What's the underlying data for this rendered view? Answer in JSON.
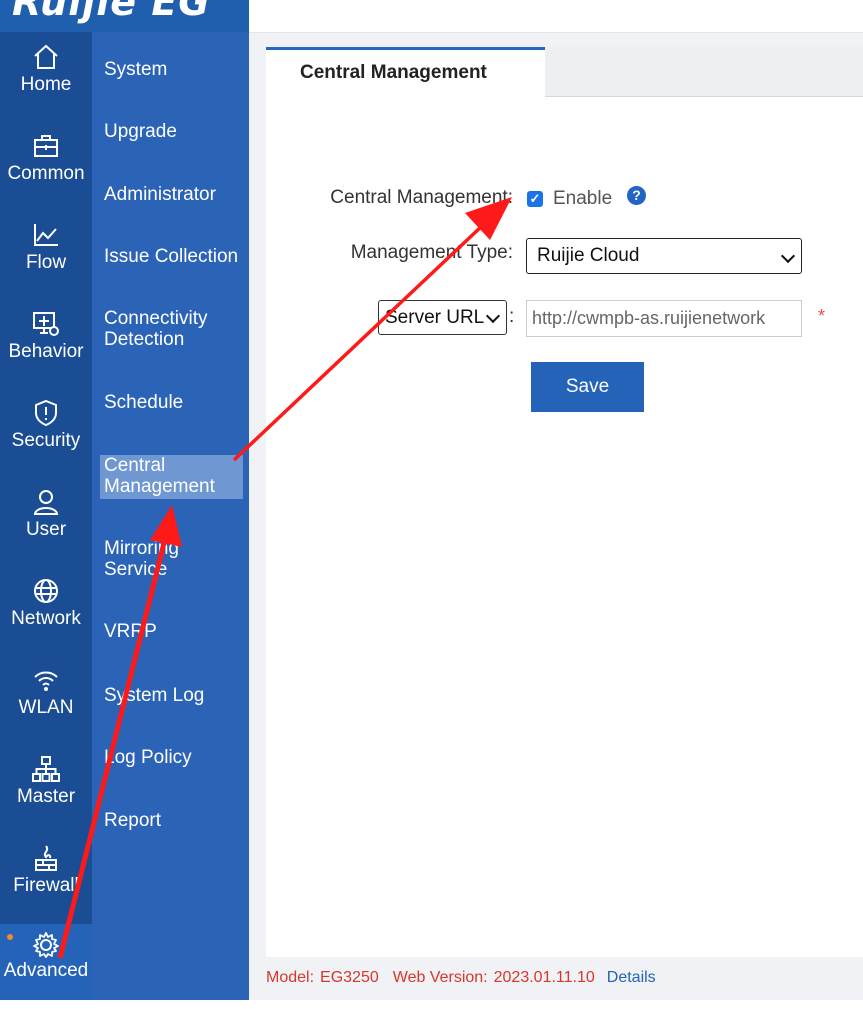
{
  "brand": "Ruijie EG",
  "icon_rail": [
    {
      "label": "Home",
      "icon": "home-icon"
    },
    {
      "label": "Common",
      "icon": "briefcase-icon"
    },
    {
      "label": "Flow",
      "icon": "line-chart-icon"
    },
    {
      "label": "Behavior",
      "icon": "monitor-eye-icon"
    },
    {
      "label": "Security",
      "icon": "shield-icon"
    },
    {
      "label": "User",
      "icon": "user-icon"
    },
    {
      "label": "Network",
      "icon": "globe-icon"
    },
    {
      "label": "WLAN",
      "icon": "wifi-icon"
    },
    {
      "label": "Master",
      "icon": "hierarchy-icon"
    },
    {
      "label": "Firewall",
      "icon": "firewall-icon"
    }
  ],
  "advanced": {
    "label": "Advanced",
    "icon": "gear-icon"
  },
  "sub_menu": [
    "System",
    "Upgrade",
    "Administrator",
    "Issue Collection",
    "Connectivity Detection",
    "Schedule",
    "Central Management",
    "Mirroring Service",
    "VRRP",
    "System Log",
    "Log Policy",
    "Report"
  ],
  "sub_menu_active": "Central Management",
  "tab": {
    "label": "Central Management"
  },
  "form": {
    "central_label": "Central Management:",
    "enable_label": "Enable",
    "enable_checked": true,
    "help_icon": "question-circle-icon",
    "type_label": "Management Type:",
    "type_value": "Ruijie Cloud",
    "url_select": "Server URL",
    "url_colon": ":",
    "url_value": "http://cwmpb-as.ruijienetwork",
    "required_mark": "*",
    "save_label": "Save"
  },
  "footer": {
    "model_label": "Model:",
    "model_value": "EG3250",
    "web_label": "Web Version:",
    "web_value": "2023.01.11.10",
    "details_label": "Details"
  },
  "colors": {
    "sidebar_dark": "#1a4d94",
    "sidebar": "#2b63b7",
    "accent": "#2563b8",
    "annotation_arrow": "#ff1a1a",
    "footer_text": "#d9362b"
  }
}
